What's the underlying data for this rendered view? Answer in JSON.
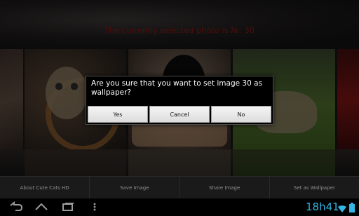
{
  "header": {
    "selected_text": "The currently selected photo is №: 30"
  },
  "gallery": {
    "photos": [
      {
        "name": "photo-left-partial"
      },
      {
        "name": "photo-kitten-wheel"
      },
      {
        "name": "photo-black-kitten"
      },
      {
        "name": "photo-tabby-grass"
      },
      {
        "name": "photo-right-partial"
      }
    ]
  },
  "actionbar": {
    "items": [
      {
        "label": "About Cute Cats HD"
      },
      {
        "label": "Save Image"
      },
      {
        "label": "Share Image"
      },
      {
        "label": "Set as Wallpaper"
      }
    ]
  },
  "dialog": {
    "message": "Are you sure that you want to set image 30 as wallpaper?",
    "yes_label": "Yes",
    "cancel_label": "Cancel",
    "no_label": "No"
  },
  "systembar": {
    "back_icon": "back-arrow-icon",
    "home_icon": "home-icon",
    "recents_icon": "recent-apps-icon",
    "menu_icon": "overflow-menu-icon",
    "time": "18h41",
    "accent": "#33b5e5"
  }
}
